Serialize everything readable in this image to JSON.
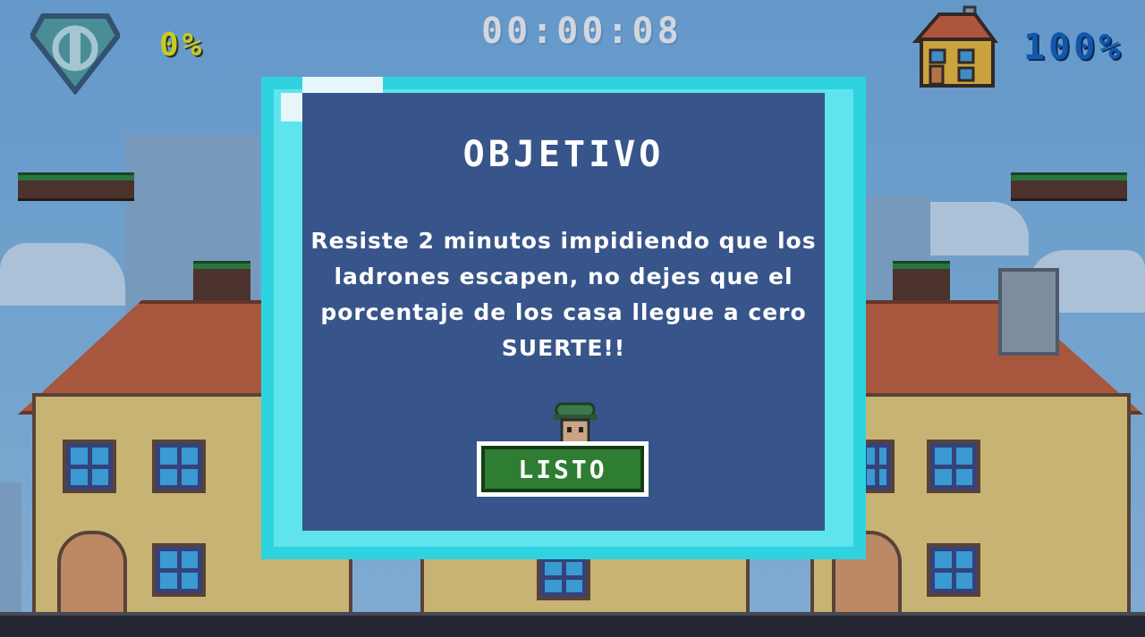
{
  "hud": {
    "timer": "00:00:08",
    "thief_percent": "0%",
    "house_percent": "100%",
    "shield_icon": "shield-icon",
    "house_icon": "house-icon"
  },
  "modal": {
    "title": "OBJETIVO",
    "message": "Resiste 2 minutos impidiendo que los ladrones escapen, no dejes que el porcentaje de los casa llegue a cero SUERTE!!",
    "button_label": "LISTO"
  },
  "colors": {
    "timer": "#ffffff",
    "thief_percent": "#f2f21e",
    "house_percent": "#1565c0",
    "modal_border": "#2fd3e0",
    "button": "#2e7d32"
  }
}
